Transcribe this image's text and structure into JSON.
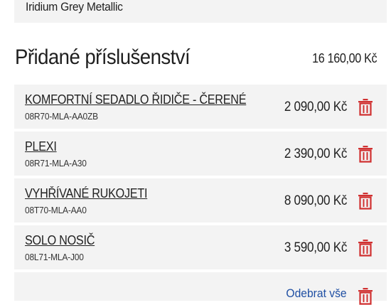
{
  "color_bar": {
    "label": "Iridium Grey Metallic"
  },
  "section": {
    "title": "Přidané příslušenství",
    "total": "16 160,00 Kč"
  },
  "items": [
    {
      "name": "KOMFORTNÍ SEDADLO ŘIDIČE - ČERENÉ",
      "code": "08R70-MLA-AA0ZB",
      "price": "2 090,00 Kč"
    },
    {
      "name": "PLEXI",
      "code": "08R71-MLA-A30",
      "price": "2 390,00 Kč"
    },
    {
      "name": "VYHŘÍVANÉ RUKOJETI",
      "code": "08T70-MLA-AA0",
      "price": "8 090,00 Kč"
    },
    {
      "name": "SOLO NOSIČ",
      "code": "08L71-MLA-J00",
      "price": "3 590,00 Kč"
    }
  ],
  "remove_all": {
    "label": "Odebrat vše"
  },
  "colors": {
    "accent": "#d03131",
    "link": "#1f4fa3",
    "row_bg": "#f3f3f3"
  },
  "icons": {
    "delete": "trash-icon"
  }
}
